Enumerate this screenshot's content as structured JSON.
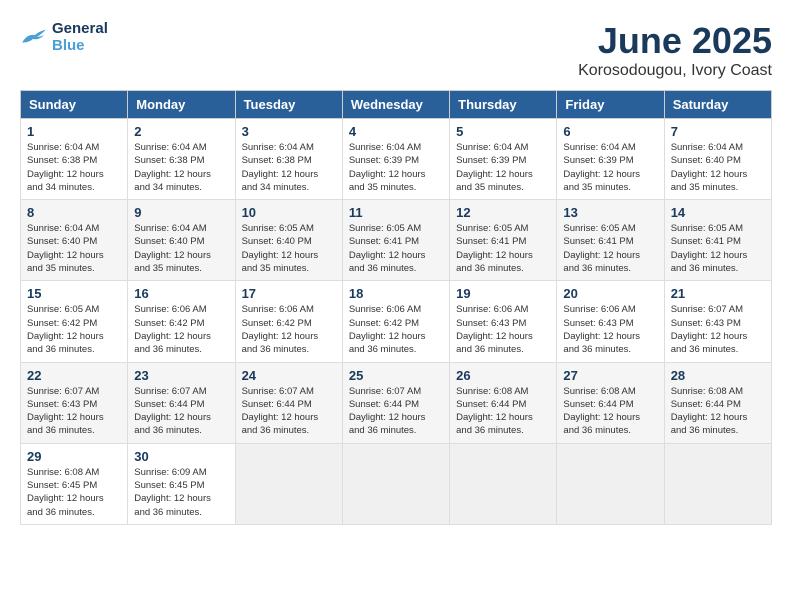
{
  "logo": {
    "line1": "General",
    "line2": "Blue"
  },
  "title": "June 2025",
  "location": "Korosodougou, Ivory Coast",
  "headers": [
    "Sunday",
    "Monday",
    "Tuesday",
    "Wednesday",
    "Thursday",
    "Friday",
    "Saturday"
  ],
  "weeks": [
    [
      {
        "day": "1",
        "sunrise": "6:04 AM",
        "sunset": "6:38 PM",
        "daylight": "12 hours and 34 minutes."
      },
      {
        "day": "2",
        "sunrise": "6:04 AM",
        "sunset": "6:38 PM",
        "daylight": "12 hours and 34 minutes."
      },
      {
        "day": "3",
        "sunrise": "6:04 AM",
        "sunset": "6:38 PM",
        "daylight": "12 hours and 34 minutes."
      },
      {
        "day": "4",
        "sunrise": "6:04 AM",
        "sunset": "6:39 PM",
        "daylight": "12 hours and 35 minutes."
      },
      {
        "day": "5",
        "sunrise": "6:04 AM",
        "sunset": "6:39 PM",
        "daylight": "12 hours and 35 minutes."
      },
      {
        "day": "6",
        "sunrise": "6:04 AM",
        "sunset": "6:39 PM",
        "daylight": "12 hours and 35 minutes."
      },
      {
        "day": "7",
        "sunrise": "6:04 AM",
        "sunset": "6:40 PM",
        "daylight": "12 hours and 35 minutes."
      }
    ],
    [
      {
        "day": "8",
        "sunrise": "6:04 AM",
        "sunset": "6:40 PM",
        "daylight": "12 hours and 35 minutes."
      },
      {
        "day": "9",
        "sunrise": "6:04 AM",
        "sunset": "6:40 PM",
        "daylight": "12 hours and 35 minutes."
      },
      {
        "day": "10",
        "sunrise": "6:05 AM",
        "sunset": "6:40 PM",
        "daylight": "12 hours and 35 minutes."
      },
      {
        "day": "11",
        "sunrise": "6:05 AM",
        "sunset": "6:41 PM",
        "daylight": "12 hours and 36 minutes."
      },
      {
        "day": "12",
        "sunrise": "6:05 AM",
        "sunset": "6:41 PM",
        "daylight": "12 hours and 36 minutes."
      },
      {
        "day": "13",
        "sunrise": "6:05 AM",
        "sunset": "6:41 PM",
        "daylight": "12 hours and 36 minutes."
      },
      {
        "day": "14",
        "sunrise": "6:05 AM",
        "sunset": "6:41 PM",
        "daylight": "12 hours and 36 minutes."
      }
    ],
    [
      {
        "day": "15",
        "sunrise": "6:05 AM",
        "sunset": "6:42 PM",
        "daylight": "12 hours and 36 minutes."
      },
      {
        "day": "16",
        "sunrise": "6:06 AM",
        "sunset": "6:42 PM",
        "daylight": "12 hours and 36 minutes."
      },
      {
        "day": "17",
        "sunrise": "6:06 AM",
        "sunset": "6:42 PM",
        "daylight": "12 hours and 36 minutes."
      },
      {
        "day": "18",
        "sunrise": "6:06 AM",
        "sunset": "6:42 PM",
        "daylight": "12 hours and 36 minutes."
      },
      {
        "day": "19",
        "sunrise": "6:06 AM",
        "sunset": "6:43 PM",
        "daylight": "12 hours and 36 minutes."
      },
      {
        "day": "20",
        "sunrise": "6:06 AM",
        "sunset": "6:43 PM",
        "daylight": "12 hours and 36 minutes."
      },
      {
        "day": "21",
        "sunrise": "6:07 AM",
        "sunset": "6:43 PM",
        "daylight": "12 hours and 36 minutes."
      }
    ],
    [
      {
        "day": "22",
        "sunrise": "6:07 AM",
        "sunset": "6:43 PM",
        "daylight": "12 hours and 36 minutes."
      },
      {
        "day": "23",
        "sunrise": "6:07 AM",
        "sunset": "6:44 PM",
        "daylight": "12 hours and 36 minutes."
      },
      {
        "day": "24",
        "sunrise": "6:07 AM",
        "sunset": "6:44 PM",
        "daylight": "12 hours and 36 minutes."
      },
      {
        "day": "25",
        "sunrise": "6:07 AM",
        "sunset": "6:44 PM",
        "daylight": "12 hours and 36 minutes."
      },
      {
        "day": "26",
        "sunrise": "6:08 AM",
        "sunset": "6:44 PM",
        "daylight": "12 hours and 36 minutes."
      },
      {
        "day": "27",
        "sunrise": "6:08 AM",
        "sunset": "6:44 PM",
        "daylight": "12 hours and 36 minutes."
      },
      {
        "day": "28",
        "sunrise": "6:08 AM",
        "sunset": "6:44 PM",
        "daylight": "12 hours and 36 minutes."
      }
    ],
    [
      {
        "day": "29",
        "sunrise": "6:08 AM",
        "sunset": "6:45 PM",
        "daylight": "12 hours and 36 minutes."
      },
      {
        "day": "30",
        "sunrise": "6:09 AM",
        "sunset": "6:45 PM",
        "daylight": "12 hours and 36 minutes."
      },
      null,
      null,
      null,
      null,
      null
    ]
  ],
  "labels": {
    "sunrise": "Sunrise:",
    "sunset": "Sunset:",
    "daylight": "Daylight:"
  }
}
